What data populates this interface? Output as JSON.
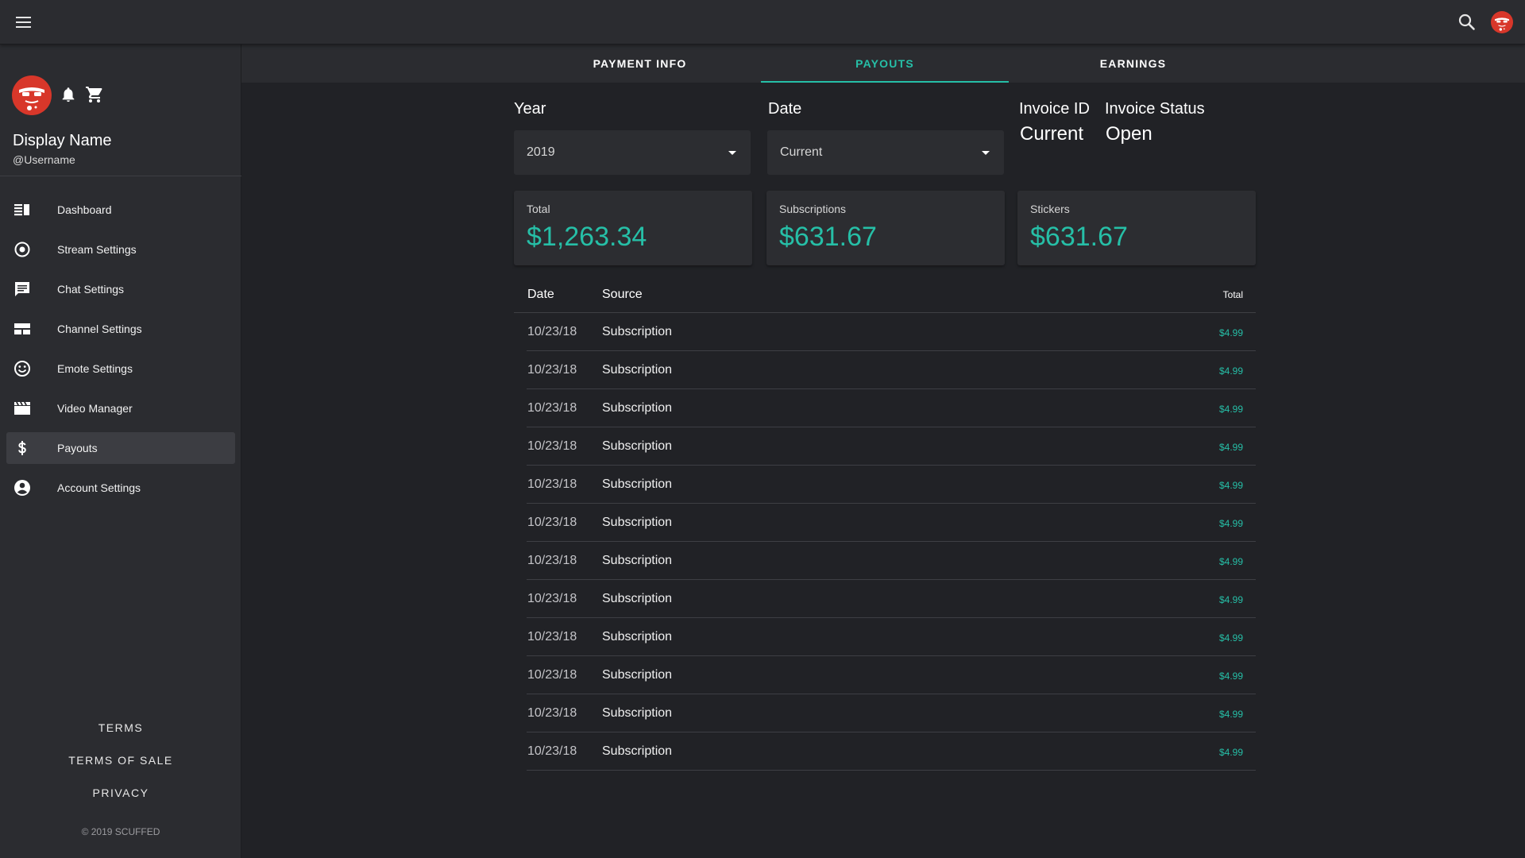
{
  "colors": {
    "accent": "#26bfa7",
    "background": "#212226",
    "surface": "#2b2c30",
    "avatar": "#d8372a"
  },
  "topbar": {
    "menu_icon": "menu-icon",
    "search_icon": "search-icon",
    "avatar_icon": "avatar-icon"
  },
  "profile": {
    "display_name": "Display Name",
    "username": "@Username",
    "icons": [
      "avatar-icon",
      "bell-icon",
      "cart-icon"
    ]
  },
  "sidebar": {
    "items": [
      {
        "label": "Dashboard",
        "icon": "dashboard-icon"
      },
      {
        "label": "Stream Settings",
        "icon": "radio-target-icon"
      },
      {
        "label": "Chat Settings",
        "icon": "chat-icon"
      },
      {
        "label": "Channel Settings",
        "icon": "layout-icon"
      },
      {
        "label": "Emote Settings",
        "icon": "smiley-icon"
      },
      {
        "label": "Video Manager",
        "icon": "clapperboard-icon"
      },
      {
        "label": "Payouts",
        "icon": "dollar-icon",
        "active": true
      },
      {
        "label": "Account Settings",
        "icon": "account-circle-icon"
      }
    ],
    "footer": [
      "TERMS",
      "TERMS OF SALE",
      "PRIVACY"
    ],
    "copyright": "© 2019 SCUFFED"
  },
  "tabs": [
    {
      "label": "PAYMENT INFO"
    },
    {
      "label": "PAYOUTS",
      "active": true
    },
    {
      "label": "EARNINGS"
    }
  ],
  "filters": {
    "year": {
      "label": "Year",
      "value": "2019"
    },
    "date": {
      "label": "Date",
      "value": "Current"
    },
    "invoice_id": {
      "label": "Invoice ID",
      "value": "Current"
    },
    "invoice_status": {
      "label": "Invoice Status",
      "value": "Open"
    }
  },
  "cards": [
    {
      "label": "Total",
      "value": "$1,263.34"
    },
    {
      "label": "Subscriptions",
      "value": "$631.67"
    },
    {
      "label": "Stickers",
      "value": "$631.67"
    }
  ],
  "table": {
    "headers": {
      "date": "Date",
      "source": "Source",
      "total": "Total"
    },
    "rows": [
      {
        "date": "10/23/18",
        "source": "Subscription",
        "total": "$4.99"
      },
      {
        "date": "10/23/18",
        "source": "Subscription",
        "total": "$4.99"
      },
      {
        "date": "10/23/18",
        "source": "Subscription",
        "total": "$4.99"
      },
      {
        "date": "10/23/18",
        "source": "Subscription",
        "total": "$4.99"
      },
      {
        "date": "10/23/18",
        "source": "Subscription",
        "total": "$4.99"
      },
      {
        "date": "10/23/18",
        "source": "Subscription",
        "total": "$4.99"
      },
      {
        "date": "10/23/18",
        "source": "Subscription",
        "total": "$4.99"
      },
      {
        "date": "10/23/18",
        "source": "Subscription",
        "total": "$4.99"
      },
      {
        "date": "10/23/18",
        "source": "Subscription",
        "total": "$4.99"
      },
      {
        "date": "10/23/18",
        "source": "Subscription",
        "total": "$4.99"
      },
      {
        "date": "10/23/18",
        "source": "Subscription",
        "total": "$4.99"
      },
      {
        "date": "10/23/18",
        "source": "Subscription",
        "total": "$4.99"
      }
    ]
  }
}
